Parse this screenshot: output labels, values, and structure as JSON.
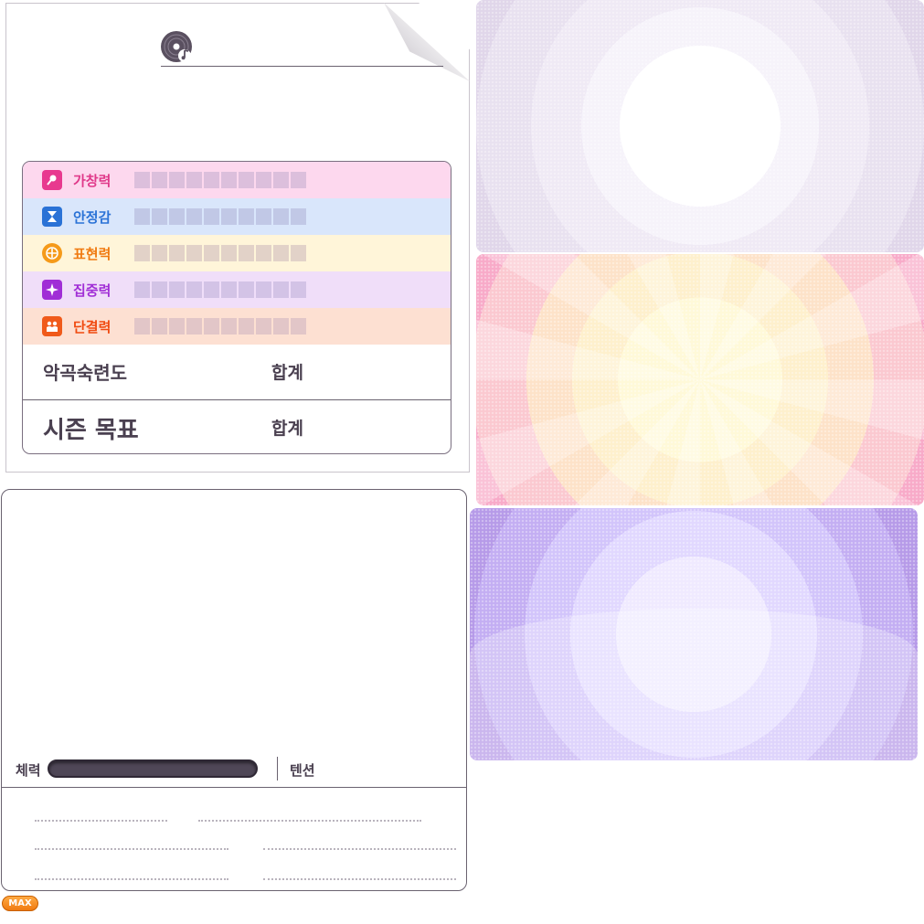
{
  "song_sheet": {
    "icon": "disc-music-icon",
    "stats": [
      {
        "label": "가창력",
        "icon": "microphone-icon",
        "color": "#e0398a",
        "row_bg": "#fdd8ee",
        "icon_bg": "#e8398f",
        "cell": "#dcbfdc"
      },
      {
        "label": "안정감",
        "icon": "hourglass-icon",
        "color": "#2a72d6",
        "row_bg": "#d9e6fb",
        "icon_bg": "#2a72d6",
        "cell": "#c1c8e6"
      },
      {
        "label": "표현력",
        "icon": "target-icon",
        "color": "#f07a10",
        "row_bg": "#fff5d9",
        "icon_bg": "#f59a1a",
        "cell": "#e2d2c8"
      },
      {
        "label": "집중력",
        "icon": "sparkle-icon",
        "color": "#a02ed6",
        "row_bg": "#f0def9",
        "icon_bg": "#a02ed6",
        "cell": "#d3c3e6"
      },
      {
        "label": "단결력",
        "icon": "group-icon",
        "color": "#f04a10",
        "row_bg": "#fde0d2",
        "icon_bg": "#f05a1a",
        "cell": "#e2c6c8"
      }
    ],
    "mastery_label": "악곡숙련도",
    "mastery_sum_label": "합계",
    "season_label": "시즌 목표",
    "season_sum_label": "합계"
  },
  "status_panel": {
    "hp_label": "체력",
    "tension_label": "텐션"
  },
  "badge": {
    "max_label": "MAX"
  }
}
